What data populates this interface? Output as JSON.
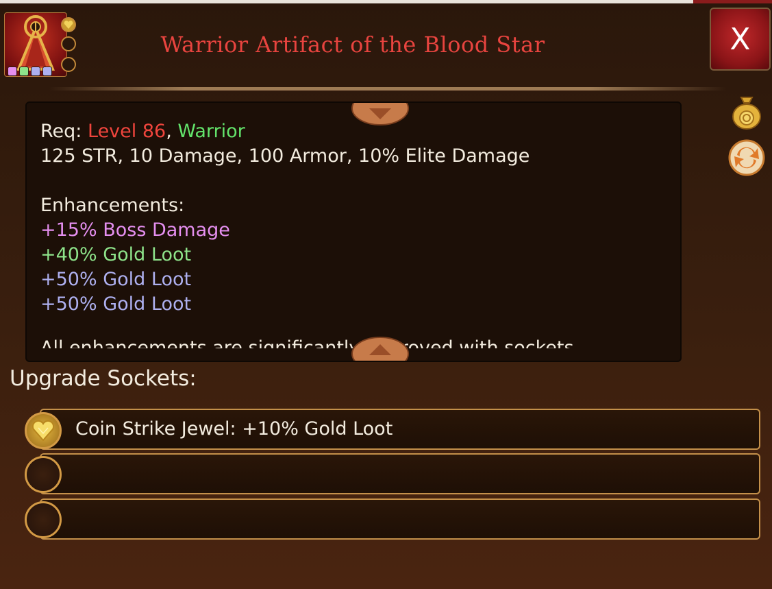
{
  "item": {
    "title": "Warrior Artifact of the Blood Star",
    "close_label": "X"
  },
  "description": {
    "req_label": "Req:",
    "req_level": "Level 86",
    "req_sep": ",",
    "req_class": "Warrior",
    "stats": "125 STR, 10 Damage, 100 Armor, 10% Elite Damage",
    "enhancements_label": "Enhancements:",
    "enhancements": [
      "+15% Boss Damage",
      "+40% Gold Loot",
      "+50% Gold Loot",
      "+50% Gold Loot"
    ],
    "cut_line": "All enhancements are significantly improved with sockets"
  },
  "sockets": {
    "header": "Upgrade Sockets:",
    "rows": [
      {
        "label": "Coin Strike Jewel: +10% Gold Loot",
        "filled": true
      },
      {
        "label": "",
        "filled": false
      },
      {
        "label": "",
        "filled": false
      }
    ]
  },
  "icons": {
    "item": "red-pyramid-artifact-icon",
    "side_top": "gold-loot-bag-icon",
    "side_bottom": "swap-arrows-icon",
    "socket_gem": "gold-heart-jewel-icon"
  },
  "colors": {
    "title": "#e8443f",
    "level": "#f0453d",
    "class": "#63e36b",
    "enh_1": "#e58ff0",
    "enh_2": "#8ee38a",
    "enh_3": "#aeb0f0",
    "enh_4": "#aeb0f0",
    "close_bg": "#8a1417",
    "socket_border": "#c4904a"
  }
}
